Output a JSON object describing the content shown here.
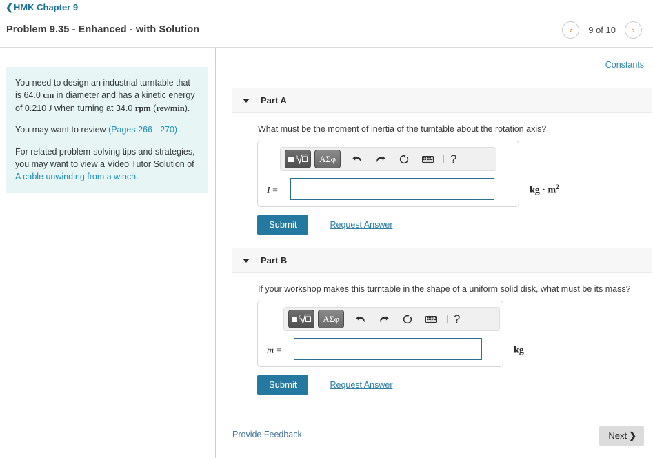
{
  "header": {
    "breadcrumb_chevron": "chevron-left-icon",
    "breadcrumb_label": "HMK Chapter 9",
    "problem_title": "Problem 9.35 - Enhanced - with Solution",
    "prev_label": "‹",
    "next_label": "›",
    "page_indicator": "9 of 10"
  },
  "left_panel": {
    "intro_1": "You need to design an industrial turntable that is 64.0",
    "intro_1_unit": "cm",
    "intro_2": " in diameter and has a kinetic energy of 0.210 ",
    "intro_2_unit": "J",
    "intro_3": " when turning at 34.0 ",
    "intro_3_unit": "rpm",
    "intro_4": " (",
    "intro_4_unit": "rev/min",
    "intro_5": ").",
    "review_prefix": "You may want to review ",
    "review_link": "(Pages 266 - 270)",
    "review_suffix": " .",
    "tips_prefix": "For related problem-solving tips and strategies, you may want to view a Video Tutor Solution of ",
    "tips_link": "A cable unwinding from a winch",
    "tips_suffix": "."
  },
  "right_panel": {
    "constants_label": "Constants",
    "parts": [
      {
        "label": "Part A",
        "question": "What must be the moment of inertia of the turntable about the rotation axis?",
        "variable": "I",
        "equals": "=",
        "input_value": "",
        "input_placeholder": "",
        "units": "kg · m",
        "units_exponent": "2",
        "submit_label": "Submit",
        "request_answer_label": "Request Answer"
      },
      {
        "label": "Part B",
        "question": "If your workshop makes this turntable in the shape of a uniform solid disk, what must be its mass?",
        "variable": "m",
        "equals": "=",
        "input_value": "",
        "input_placeholder": "",
        "units": "kg",
        "units_exponent": "",
        "submit_label": "Submit",
        "request_answer_label": "Request Answer"
      }
    ],
    "toolbar": {
      "template_btn_label": "■√□",
      "greek_btn_label": "ΑΣφ",
      "undo_icon": "undo-arrow-icon",
      "redo_icon": "redo-arrow-icon",
      "reset_icon": "reset-circular-arrow-icon",
      "keyboard_icon": "keyboard-icon",
      "help_label": "?"
    },
    "footer": {
      "feedback_label": "Provide Feedback",
      "next_label": "Next",
      "next_chevron": "❯"
    }
  },
  "colors": {
    "accent_link": "#1b6f95",
    "submit_bg": "#2578a0",
    "info_box_bg": "#e7f5f4",
    "part_header_bg": "#f7f7f7",
    "input_border": "#2a6f91",
    "pager_arrow": "#e07a1f"
  }
}
